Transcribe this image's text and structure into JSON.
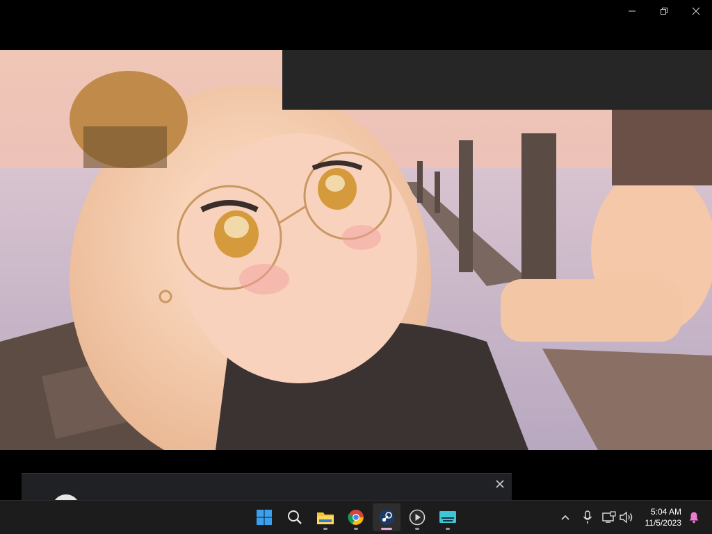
{
  "window": {
    "controls": [
      "minimize",
      "restore",
      "close"
    ]
  },
  "scene": {
    "colors": {
      "sky": "#e9c2b8",
      "sea": "#c7b6c4",
      "hair": "#f2cdb0",
      "shirt": "#3b3331",
      "dock": "#5a4c45",
      "eyes": "#d99a3a"
    }
  },
  "notification": {
    "close_icon": "close-icon"
  },
  "taskbar": {
    "apps": [
      {
        "name": "start-button",
        "icon": "windows-logo-icon"
      },
      {
        "name": "search-button",
        "icon": "search-icon"
      },
      {
        "name": "file-explorer",
        "icon": "folder-icon"
      },
      {
        "name": "chrome",
        "icon": "chrome-icon"
      },
      {
        "name": "steam",
        "icon": "steam-icon",
        "active": true
      },
      {
        "name": "media-player",
        "icon": "play-icon"
      },
      {
        "name": "screen-app",
        "icon": "screen-icon"
      }
    ],
    "tray": [
      "chevron-up-icon",
      "microphone-icon",
      "network-icon",
      "volume-icon"
    ],
    "clock": {
      "time": "5:04 AM",
      "date": "11/5/2023"
    },
    "notification_icon": "bell-icon"
  }
}
